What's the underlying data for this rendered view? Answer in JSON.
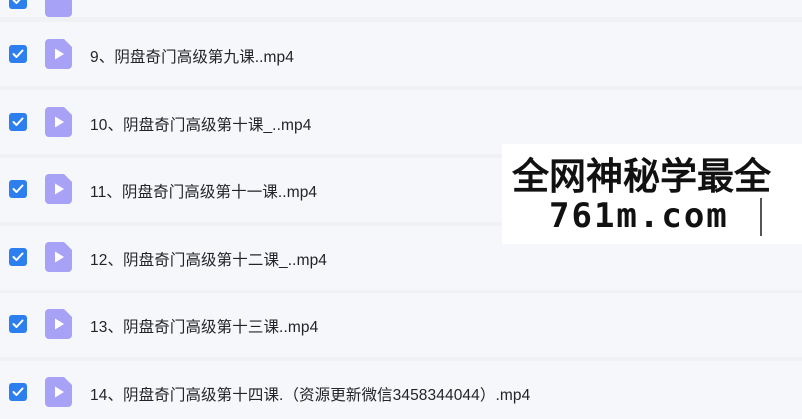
{
  "files": [
    {
      "name": "",
      "checked": true,
      "icon": "video-file-icon"
    },
    {
      "name": "9、阴盘奇门高级第九课..mp4",
      "checked": true,
      "icon": "video-file-icon"
    },
    {
      "name": "10、阴盘奇门高级第十课_..mp4",
      "checked": true,
      "icon": "video-file-icon"
    },
    {
      "name": "11、阴盘奇门高级第十一课..mp4",
      "checked": true,
      "icon": "video-file-icon"
    },
    {
      "name": "12、阴盘奇门高级第十二课_..mp4",
      "checked": true,
      "icon": "video-file-icon"
    },
    {
      "name": "13、阴盘奇门高级第十三课..mp4",
      "checked": true,
      "icon": "video-file-icon"
    },
    {
      "name": "14、阴盘奇门高级第十四课.（资源更新微信3458344044）.mp4",
      "checked": true,
      "icon": "video-file-icon"
    }
  ],
  "watermark": {
    "line1": "全网神秘学最全",
    "line2": "761m.com"
  },
  "colors": {
    "checkbox": "#2d7ff0",
    "file_icon": "#a8a2f7",
    "row_bg": "#f6f7fb",
    "separator": "#f0f1f5"
  }
}
